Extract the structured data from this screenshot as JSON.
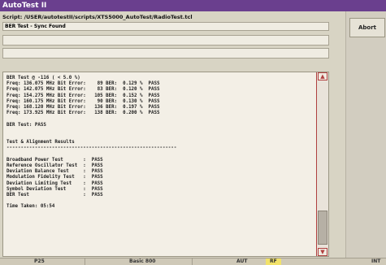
{
  "window": {
    "title": "AutoTest II"
  },
  "script": {
    "label": "Script: /USER/autotestII/scripts/XTS5000_AutoTest/RadioTest.tcl"
  },
  "status_message": "BER Test - Sync Found",
  "buttons": {
    "abort": "Abort"
  },
  "log": {
    "ber_header": "BER Test @ -116 ( < 5.0 %)",
    "freq_lines": [
      "Freq: 136.075 MHz Bit Error:    89 BER:  0.129 %  PASS",
      "Freq: 142.075 MHz Bit Error:    83 BER:  0.120 %  PASS",
      "Freq: 154.275 MHz Bit Error:   105 BER:  0.152 %  PASS",
      "Freq: 160.175 MHz Bit Error:    90 BER:  0.130 %  PASS",
      "Freq: 168.120 MHz Bit Error:   136 BER:  0.197 %  PASS",
      "Freq: 173.925 MHz Bit Error:   138 BER:  0.200 %  PASS"
    ],
    "ber_result": "BER Test: PASS",
    "results_header": "Test & Alignment Results",
    "separator": "------------------------------------------------------------",
    "results": [
      "Broadband Power Test       :  PASS",
      "Reference Oscillator Test  :  PASS",
      "Deviation Balance Test     :  PASS",
      "Modulation Fidelity Test   :  PASS",
      "Deviation Limiting Test    :  PASS",
      "Symbol Deviation Test      :  PASS",
      "BER Test                   :  PASS"
    ],
    "time_taken": "Time Taken: 05:54"
  },
  "statusbar": {
    "p25": "P25",
    "basic": "Basic 800",
    "aut": "AUT",
    "rf": "RF",
    "int": "INT"
  },
  "colors": {
    "titlebar": "#6a3f8e",
    "rf_highlight": "#f2e26a",
    "scroll_border": "#b04040"
  }
}
